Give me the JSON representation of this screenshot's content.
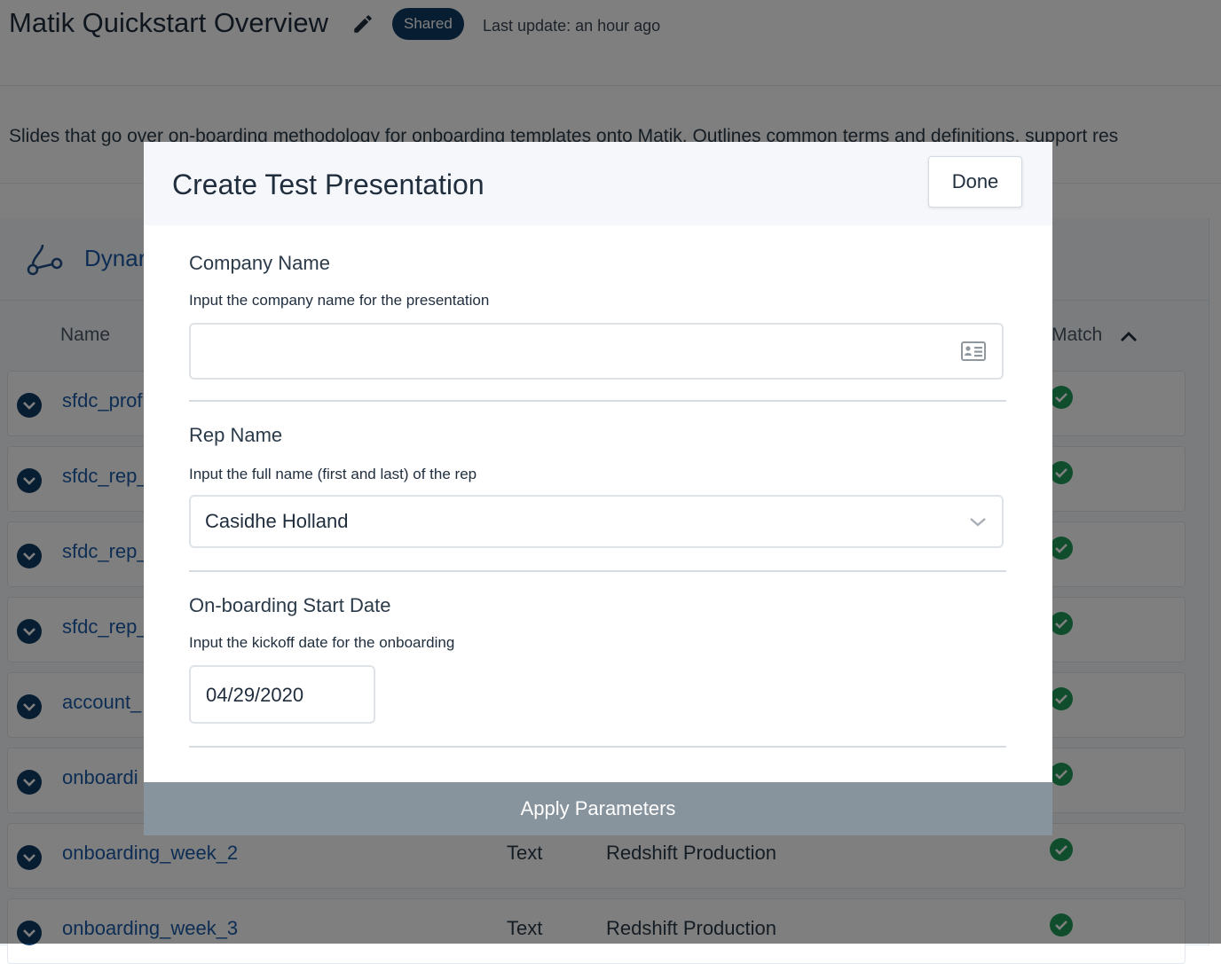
{
  "page": {
    "title": "Matik Quickstart Overview",
    "badge": "Shared",
    "last_update": "Last update: an hour ago",
    "description": "Slides that go over on-boarding methodology for onboarding templates onto Matik. Outlines common terms and definitions, support res",
    "panel_title_visible": "Dynar",
    "columns": {
      "name": "Name",
      "match": "Match"
    },
    "rows": [
      {
        "name": "sfdc_prof",
        "type": "",
        "source": ""
      },
      {
        "name": "sfdc_rep_",
        "type": "",
        "source": ""
      },
      {
        "name": "sfdc_rep_",
        "type": "",
        "source": ""
      },
      {
        "name": "sfdc_rep_",
        "type": "",
        "source": ""
      },
      {
        "name": "account_",
        "type": "",
        "source": ""
      },
      {
        "name": "onboardi",
        "type": "",
        "source": ""
      },
      {
        "name": "onboarding_week_2",
        "type": "Text",
        "source": "Redshift Production"
      },
      {
        "name": "onboarding_week_3",
        "type": "Text",
        "source": "Redshift Production"
      }
    ]
  },
  "modal": {
    "title": "Create Test Presentation",
    "done_label": "Done",
    "fields": [
      {
        "label": "Company Name",
        "help": "Input the company name for the presentation",
        "value": ""
      },
      {
        "label": "Rep Name",
        "help": "Input the full name (first and last) of the rep",
        "value": "Casidhe Holland"
      },
      {
        "label": "On-boarding Start Date",
        "help": "Input the kickoff date for the onboarding",
        "value": "04/29/2020"
      }
    ],
    "apply_label": "Apply Parameters"
  },
  "colors": {
    "brand_navy": "#0f3a63",
    "link_blue": "#1a5aa8",
    "success_green": "#1f9a5a",
    "apply_button": "#87939d"
  }
}
